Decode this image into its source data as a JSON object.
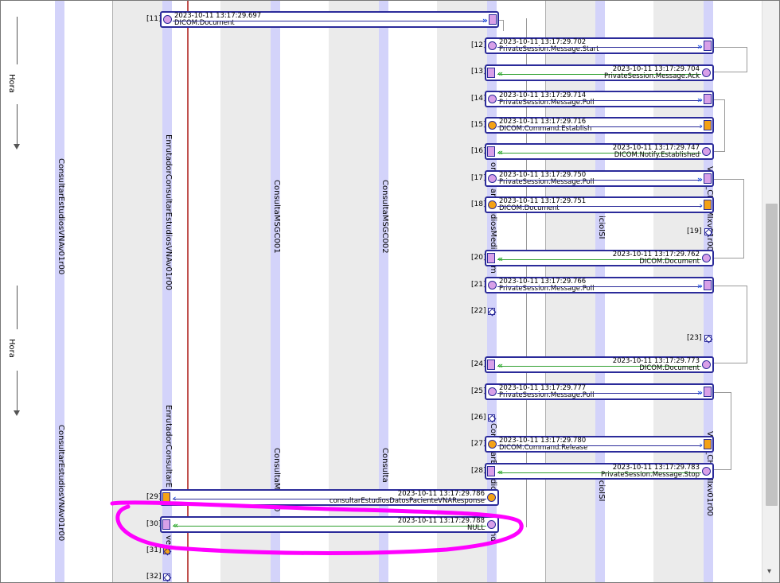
{
  "time_axis": {
    "labels": [
      "Hora",
      "Hora"
    ]
  },
  "participants": {
    "p1": "ConsultarEstudiosVNAv01r00",
    "p2": "EnrutadorConsultarEstudiosVNAv01r00",
    "p2_fragment": "EnrutadorConsultarE",
    "p3": "ConsultaMSGC001",
    "p3_fragment": "ConsultaM",
    "p4": "ConsultaMSGC002",
    "p4_fragment": "Consulta",
    "p5_fragment_top": "or",
    "p5_fragment_mid": "arEstudiosMedia",
    "p5_fragment_end": "m",
    "p5_fragment_bottom": "Cor",
    "p5_fragment_bottom_mid": "arE",
    "p5_fragment_bottom_end": "dio",
    "p5_fragment_tail": "Ind",
    "p6_fragment": "icioISI",
    "p6_fragment_bottom": "icioISI",
    "p7_fragment": "VsaP_CHUIMIxv01r00",
    "p7_fragment_top": "V",
    "p7_fragment_bottom": "VsaP_CHUIMIxv01r00",
    "p2_fragment_b": "ve",
    "p2_fragment_c": "0"
  },
  "messages": [
    {
      "idx": "[11]",
      "ts": "2023-10-11 13:17:29.697",
      "name": "DICOM.Document"
    },
    {
      "idx": "[12]",
      "ts": "2023-10-11 13:17:29.702",
      "name": "PrivateSession.Message.Start"
    },
    {
      "idx": "[13]",
      "ts": "2023-10-11 13:17:29.704",
      "name": "PrivateSession.Message.Ack"
    },
    {
      "idx": "[14]",
      "ts": "2023-10-11 13:17:29.714",
      "name": "PrivateSession.Message.Poll"
    },
    {
      "idx": "[15]",
      "ts": "2023-10-11 13:17:29.716",
      "name": "DICOM.Command.Establish"
    },
    {
      "idx": "[16]",
      "ts": "2023-10-11 13:17:29.747",
      "name": "DICOM.Notify.Established"
    },
    {
      "idx": "[17]",
      "ts": "2023-10-11 13:17:29.750",
      "name": "PrivateSession.Message.Poll"
    },
    {
      "idx": "[18]",
      "ts": "2023-10-11 13:17:29.751",
      "name": "DICOM.Document"
    },
    {
      "idx": "[20]",
      "ts": "2023-10-11 13:17:29.762",
      "name": "DICOM.Document"
    },
    {
      "idx": "[21]",
      "ts": "2023-10-11 13:17:29.766",
      "name": "PrivateSession.Message.Poll"
    },
    {
      "idx": "[24]",
      "ts": "2023-10-11 13:17:29.773",
      "name": "DICOM.Document"
    },
    {
      "idx": "[25]",
      "ts": "2023-10-11 13:17:29.777",
      "name": "PrivateSession.Message.Poll"
    },
    {
      "idx": "[27]",
      "ts": "2023-10-11 13:17:29.780",
      "name": "DICOM.Command.Release"
    },
    {
      "idx": "[28]",
      "ts": "2023-10-11 13:17:29.783",
      "name": "PrivateSession.Message.Stop"
    },
    {
      "idx": "[29]",
      "ts": "2023-10-11 13:17:29.786",
      "name": "consultarEstudiosDatosPacienteVNAResponse"
    },
    {
      "idx": "[30]",
      "ts": "2023-10-11 13:17:29.788",
      "name": "NULL"
    }
  ],
  "markers": {
    "m19": "[19]",
    "m22": "[22]",
    "m23": "[23]",
    "m26": "[26]",
    "m31": "[31]",
    "m32": "[32]"
  },
  "colors": {
    "lifeline": "#d3d3fa",
    "box_border": "#2b2b9a",
    "arrow_right": "#1e4fe0",
    "arrow_left": "#1aa51a",
    "endpoint_pink": "#d8a0e8",
    "endpoint_orange": "#f4a215",
    "annotation": "#ff00ff"
  },
  "scrollbar": {
    "down_arrow": "▾"
  }
}
